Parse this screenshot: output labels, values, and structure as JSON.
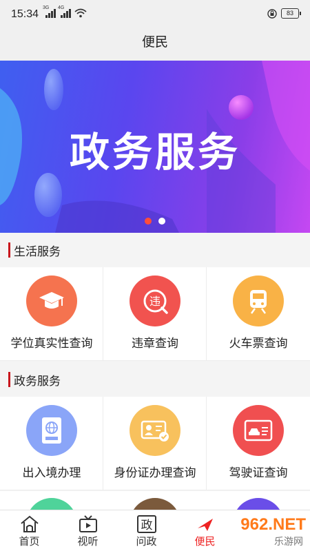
{
  "status_bar": {
    "time": "15:34",
    "signal1_label": "3G",
    "signal2_label": "4G",
    "battery": "83"
  },
  "header": {
    "title": "便民"
  },
  "banner": {
    "title": "政务服务"
  },
  "sections": [
    {
      "title": "生活服务",
      "items": [
        {
          "label": "学位真实性查询",
          "icon": "graduation-cap-icon",
          "color": "#f5734f"
        },
        {
          "label": "违章查询",
          "icon": "violation-icon",
          "color": "#f1534f"
        },
        {
          "label": "火车票查询",
          "icon": "train-icon",
          "color": "#f9b246"
        }
      ]
    },
    {
      "title": "政务服务",
      "items": [
        {
          "label": "出入境办理",
          "icon": "passport-icon",
          "color": "#8aa5f8"
        },
        {
          "label": "身份证办理查询",
          "icon": "id-card-icon",
          "color": "#f8c15d"
        },
        {
          "label": "驾驶证查询",
          "icon": "driver-license-icon",
          "color": "#f04f50"
        }
      ]
    }
  ],
  "partial_row_colors": [
    "#4fd39a",
    "#7b5a3c",
    "#6a4ee8"
  ],
  "tabs": [
    {
      "label": "首页",
      "icon": "home-icon"
    },
    {
      "label": "视听",
      "icon": "tv-icon"
    },
    {
      "label": "问政",
      "icon": "ask-gov-icon",
      "glyph": "政"
    },
    {
      "label": "便民",
      "icon": "convenience-icon"
    }
  ],
  "watermark": {
    "text": "962.NET",
    "sub": "乐游网"
  }
}
